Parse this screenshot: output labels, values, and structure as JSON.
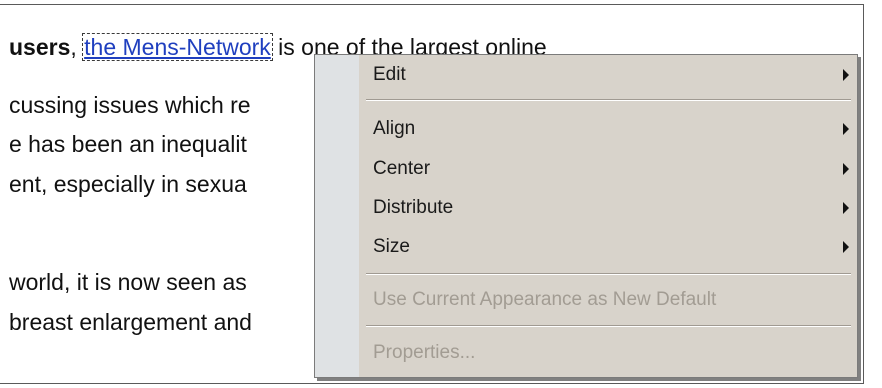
{
  "document": {
    "lines": [
      {
        "bold": "users",
        "sep": ", ",
        "link": "the Mens-Network",
        "rest": " is one of the largest online"
      },
      {
        "text": "cussing issues which re"
      },
      {
        "text": "e has been an inequalit"
      },
      {
        "text": "ent, especially in sexua"
      },
      {
        "text": "world, it is now seen as"
      },
      {
        "text": "breast enlargement and"
      }
    ]
  },
  "context_menu": {
    "items": [
      {
        "label": "Edit",
        "submenu": true,
        "enabled": true
      },
      {
        "label": "Align",
        "submenu": true,
        "enabled": true
      },
      {
        "label": "Center",
        "submenu": true,
        "enabled": true
      },
      {
        "label": "Distribute",
        "submenu": true,
        "enabled": true
      },
      {
        "label": "Size",
        "submenu": true,
        "enabled": true
      },
      {
        "label": "Use Current Appearance as New Default",
        "submenu": false,
        "enabled": false
      },
      {
        "label": "Properties...",
        "submenu": false,
        "enabled": false
      }
    ]
  },
  "colors": {
    "menu_background": "#d8d3cb",
    "menu_gutter": "#dfe2e4",
    "link": "#1f3fbf",
    "disabled_text": "#a29c93"
  }
}
